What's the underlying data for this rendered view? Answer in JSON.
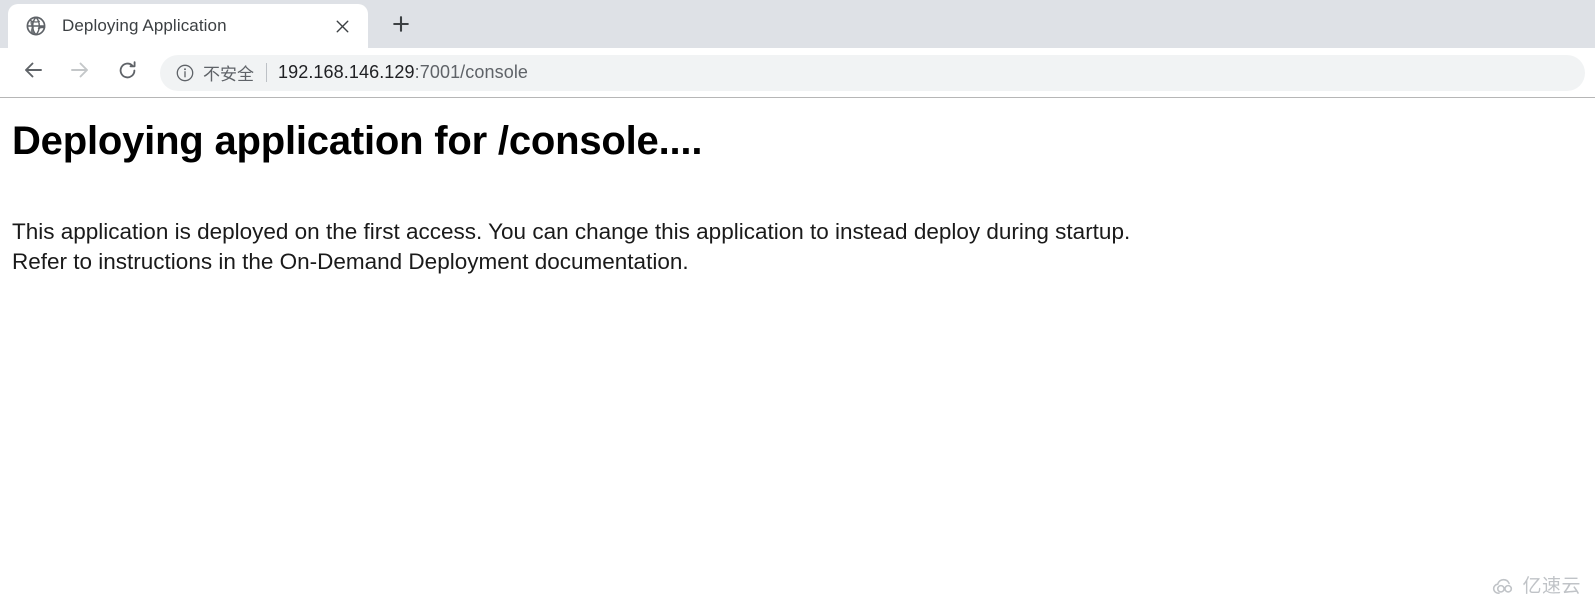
{
  "browser": {
    "tab": {
      "title": "Deploying Application",
      "favicon_icon": "globe-icon",
      "close_icon": "close-icon"
    },
    "new_tab_icon": "plus-icon",
    "toolbar": {
      "back_icon": "arrow-left-icon",
      "forward_icon": "arrow-right-icon",
      "reload_icon": "reload-icon",
      "omnibox": {
        "security_icon": "info-circle-icon",
        "security_label": "不安全",
        "url_host": "192.168.146.129",
        "url_rest": ":7001/console",
        "full_url": "192.168.146.129:7001/console"
      }
    }
  },
  "page": {
    "heading": "Deploying application for /console....",
    "paragraph_line1": "This application is deployed on the first access. You can change this application to instead deploy during startup.",
    "paragraph_line2": "Refer to instructions in the On-Demand Deployment documentation."
  },
  "watermark": {
    "icon": "cloud-icon",
    "text": "亿速云"
  },
  "colors": {
    "tabstrip_bg": "#dee1e6",
    "active_tab_bg": "#ffffff",
    "toolbar_bg": "#ffffff",
    "omnibox_bg": "#f1f3f4",
    "url_host_text": "#202124",
    "url_rest_text": "#5f6368",
    "security_text": "#5f6368",
    "page_bg": "#ffffff",
    "heading_text": "#000000",
    "body_text": "#1a1a1a",
    "watermark_text": "#9aa0a6",
    "toolbar_border": "#b6b6b6"
  }
}
